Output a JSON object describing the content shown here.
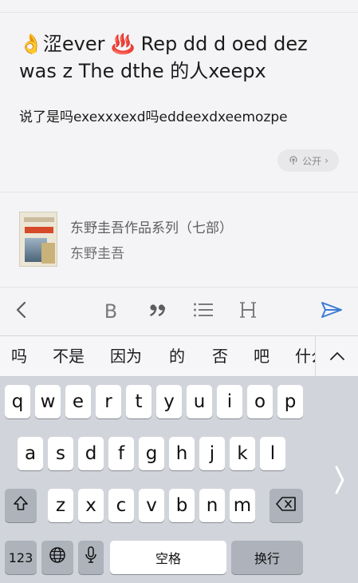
{
  "editor": {
    "title": "👌涩ever ♨️   Rep dd d oed dez was z The dthe  的人xeepx",
    "body": "说了是吗exexxxexd吗eddeexdxeemozpe",
    "visibility_label": "公开",
    "visibility_icon": "broadcast-icon",
    "visibility_chevron": "›"
  },
  "book": {
    "title": "东野圭吾作品系列（七部）",
    "author": "东野圭吾"
  },
  "toolbar": {
    "bold": "B",
    "quote": "❜",
    "heading": "H",
    "accent": "#3d7bd6"
  },
  "suggestions": {
    "items": [
      "吗",
      "不是",
      "因为",
      "的",
      "否",
      "吧",
      "什么"
    ]
  },
  "keyboard": {
    "row1": [
      "q",
      "w",
      "e",
      "r",
      "t",
      "y",
      "u",
      "i",
      "o",
      "p"
    ],
    "row2": [
      "a",
      "s",
      "d",
      "f",
      "g",
      "h",
      "j",
      "k",
      "l"
    ],
    "row3": [
      "z",
      "x",
      "c",
      "v",
      "b",
      "n",
      "m"
    ],
    "numbers_key": "123",
    "space_key": "空格",
    "return_key": "换行"
  }
}
